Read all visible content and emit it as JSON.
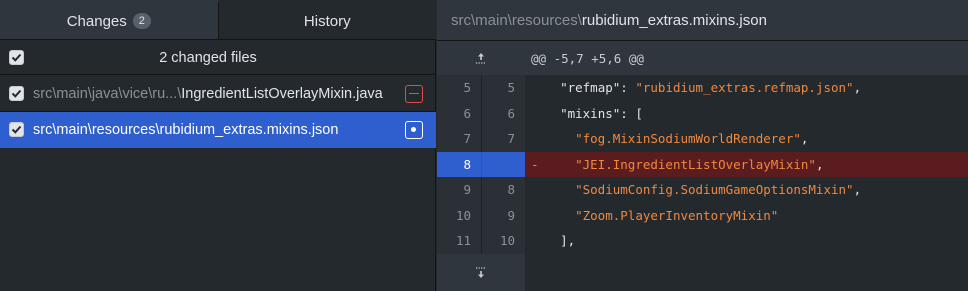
{
  "tabs": {
    "changes_label": "Changes",
    "changes_count": "2",
    "history_label": "History"
  },
  "changes": {
    "header": "2 changed files",
    "files": [
      {
        "dir": "src\\main\\java\\vice\\ru...\\",
        "name": "IngredientListOverlayMixin.java",
        "status": "removed"
      },
      {
        "dir": "src\\main\\resources\\",
        "name": "rubidium_extras.mixins.json",
        "status": "modified"
      }
    ]
  },
  "diff": {
    "file_dir": "src\\main\\resources\\",
    "file_name": "rubidium_extras.mixins.json",
    "hunk_header": "@@ -5,7 +5,6 @@",
    "lines": [
      {
        "old": "5",
        "new": "5",
        "marker": "",
        "indent": "  ",
        "key": "\"refmap\"",
        "sep": ": ",
        "value": "\"rubidium_extras.refmap.json\"",
        "tail": ","
      },
      {
        "old": "6",
        "new": "6",
        "marker": "",
        "indent": "  ",
        "key": "\"mixins\"",
        "sep": ": ",
        "value": "",
        "tail": "["
      },
      {
        "old": "7",
        "new": "7",
        "marker": "",
        "indent": "    ",
        "key": "",
        "sep": "",
        "value": "\"fog.MixinSodiumWorldRenderer\"",
        "tail": ","
      },
      {
        "old": "8",
        "new": "",
        "marker": "-",
        "indent": "    ",
        "key": "",
        "sep": "",
        "value": "\"JEI.IngredientListOverlayMixin\"",
        "tail": ","
      },
      {
        "old": "9",
        "new": "8",
        "marker": "",
        "indent": "    ",
        "key": "",
        "sep": "",
        "value": "\"SodiumConfig.SodiumGameOptionsMixin\"",
        "tail": ","
      },
      {
        "old": "10",
        "new": "9",
        "marker": "",
        "indent": "    ",
        "key": "",
        "sep": "",
        "value": "\"Zoom.PlayerInventoryMixin\"",
        "tail": ""
      },
      {
        "old": "11",
        "new": "10",
        "marker": "",
        "indent": "  ",
        "key": "",
        "sep": "",
        "value": "",
        "tail": "],"
      }
    ]
  },
  "colors": {
    "selected_row": "#2f5ecf",
    "deleted_line_bg": "#5b1c1f",
    "string": "#f0883e",
    "removed_status": "#e04b4b"
  },
  "icons": {
    "expand_up": "expand-up-icon",
    "expand_down": "expand-down-icon",
    "checkbox": "checkbox-checked-icon",
    "removed": "file-removed-icon",
    "modified": "file-modified-icon"
  }
}
